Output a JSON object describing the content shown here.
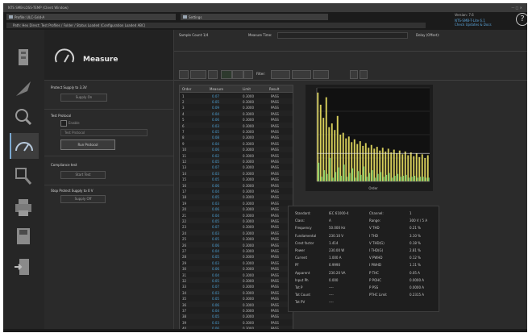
{
  "app": {
    "title": "NTS SMB-LOSS-TEMP (Client Window)",
    "window_controls": "— □ ✕",
    "tab1": "Profile: ULC-Grid-A",
    "tab2": "Settings",
    "path": "Path: Hex  Direct: Test Profiles / Folder / Status Loaded (Configuration Loaded ABC)",
    "version": "Version: 7.6",
    "link1": "NTS-SMB-T-Lite 6.1",
    "link2": "Check Updates & Docs"
  },
  "rail": {
    "items": [
      "device",
      "wave",
      "search",
      "measure",
      "inspect",
      "print",
      "export",
      "exit"
    ]
  },
  "panel": {
    "title": "Measure",
    "s1_title": "Protect Supply to 3.3V",
    "s1_btn": "Supply On",
    "s2_title": "Test Protocol",
    "s2_check": "Enable",
    "s2_field": "Test Protocol",
    "s2_btn": "Run Protocol",
    "s3_title": "Compliance test",
    "s3_btn": "Start Test",
    "s4_title": "Stop Protect Supply to 0 V",
    "s4_btn": "Supply Off"
  },
  "main": {
    "sample_count_label": "Sample Count:",
    "sample_count": "1/4",
    "measure_time_label": "Measure Time:",
    "delay_label": "Delay (Offset):",
    "filter_label": "Filter:",
    "table_headers": [
      "Order",
      "Measure",
      "Limit",
      "Result"
    ],
    "rows": [
      {
        "order": "1",
        "measure": "0.07",
        "limit": "0.3000",
        "result": "PASS"
      },
      {
        "order": "2",
        "measure": "0.05",
        "limit": "0.3000",
        "result": "PASS"
      },
      {
        "order": "3",
        "measure": "0.09",
        "limit": "0.3000",
        "result": "PASS"
      },
      {
        "order": "4",
        "measure": "0.04",
        "limit": "0.3000",
        "result": "PASS"
      },
      {
        "order": "5",
        "measure": "0.06",
        "limit": "0.3000",
        "result": "PASS"
      },
      {
        "order": "6",
        "measure": "0.03",
        "limit": "0.3000",
        "result": "PASS"
      },
      {
        "order": "7",
        "measure": "0.05",
        "limit": "0.3000",
        "result": "PASS"
      },
      {
        "order": "8",
        "measure": "0.08",
        "limit": "0.3000",
        "result": "PASS"
      },
      {
        "order": "9",
        "measure": "0.04",
        "limit": "0.3000",
        "result": "PASS"
      },
      {
        "order": "10",
        "measure": "0.06",
        "limit": "0.3000",
        "result": "PASS"
      },
      {
        "order": "11",
        "measure": "0.02",
        "limit": "0.3000",
        "result": "PASS"
      },
      {
        "order": "12",
        "measure": "0.05",
        "limit": "0.3000",
        "result": "PASS"
      },
      {
        "order": "13",
        "measure": "0.07",
        "limit": "0.3000",
        "result": "PASS"
      },
      {
        "order": "14",
        "measure": "0.03",
        "limit": "0.3000",
        "result": "PASS"
      },
      {
        "order": "15",
        "measure": "0.05",
        "limit": "0.3000",
        "result": "PASS"
      },
      {
        "order": "16",
        "measure": "0.06",
        "limit": "0.3000",
        "result": "PASS"
      },
      {
        "order": "17",
        "measure": "0.04",
        "limit": "0.3000",
        "result": "PASS"
      },
      {
        "order": "18",
        "measure": "0.05",
        "limit": "0.3000",
        "result": "PASS"
      },
      {
        "order": "19",
        "measure": "0.03",
        "limit": "0.3000",
        "result": "PASS"
      },
      {
        "order": "20",
        "measure": "0.06",
        "limit": "0.3000",
        "result": "PASS"
      },
      {
        "order": "21",
        "measure": "0.04",
        "limit": "0.3000",
        "result": "PASS"
      },
      {
        "order": "22",
        "measure": "0.05",
        "limit": "0.3000",
        "result": "PASS"
      },
      {
        "order": "23",
        "measure": "0.07",
        "limit": "0.3000",
        "result": "PASS"
      },
      {
        "order": "24",
        "measure": "0.03",
        "limit": "0.3000",
        "result": "PASS"
      },
      {
        "order": "25",
        "measure": "0.05",
        "limit": "0.3000",
        "result": "PASS"
      },
      {
        "order": "26",
        "measure": "0.06",
        "limit": "0.3000",
        "result": "PASS"
      },
      {
        "order": "27",
        "measure": "0.04",
        "limit": "0.3000",
        "result": "PASS"
      },
      {
        "order": "28",
        "measure": "0.05",
        "limit": "0.3000",
        "result": "PASS"
      },
      {
        "order": "29",
        "measure": "0.03",
        "limit": "0.3000",
        "result": "PASS"
      },
      {
        "order": "30",
        "measure": "0.06",
        "limit": "0.3000",
        "result": "PASS"
      },
      {
        "order": "31",
        "measure": "0.04",
        "limit": "0.3000",
        "result": "PASS"
      },
      {
        "order": "32",
        "measure": "0.05",
        "limit": "0.3000",
        "result": "PASS"
      },
      {
        "order": "33",
        "measure": "0.07",
        "limit": "0.3000",
        "result": "PASS"
      },
      {
        "order": "34",
        "measure": "0.03",
        "limit": "0.3000",
        "result": "PASS"
      },
      {
        "order": "35",
        "measure": "0.05",
        "limit": "0.3000",
        "result": "PASS"
      },
      {
        "order": "36",
        "measure": "0.06",
        "limit": "0.3000",
        "result": "PASS"
      },
      {
        "order": "37",
        "measure": "0.04",
        "limit": "0.3000",
        "result": "PASS"
      },
      {
        "order": "38",
        "measure": "0.05",
        "limit": "0.3000",
        "result": "PASS"
      },
      {
        "order": "39",
        "measure": "0.03",
        "limit": "0.3000",
        "result": "PASS"
      },
      {
        "order": "40",
        "measure": "0.06",
        "limit": "0.3000",
        "result": "PASS"
      }
    ],
    "stats": [
      {
        "label": "Standard:",
        "value": "IEC 61000-4",
        "label2": "Channel:",
        "value2": "1"
      },
      {
        "label": "Class:",
        "value": "A",
        "label2": "Range:",
        "value2": "300 V / 5 A"
      },
      {
        "label": "Frequency",
        "value": "50.000 Hz",
        "label2": "V THD",
        "value2": "0.21 %"
      },
      {
        "label": "Fundamental",
        "value": "230.10 V",
        "label2": "I THD",
        "value2": "3.10 %"
      },
      {
        "label": "Crest factor",
        "value": "1.414",
        "label2": "V THD(G)",
        "value2": "0.18 %"
      },
      {
        "label": "Power",
        "value": "230.00 W",
        "label2": "I THD(G)",
        "value2": "2.81 %"
      },
      {
        "label": "Current",
        "value": "1.000 A",
        "label2": "V PWHD",
        "value2": "0.12 %"
      },
      {
        "label": "PF",
        "value": "0.9990",
        "label2": "I PWHD",
        "value2": "1.11 %"
      },
      {
        "label": "Apparent",
        "value": "230.20 VA",
        "label2": "P THC",
        "value2": "0.05 A"
      },
      {
        "label": "Input Ph",
        "value": "0.000",
        "label2": "P POHC",
        "value2": "0.0000 A"
      },
      {
        "label": "Tot P",
        "value": "----",
        "label2": "P PSS",
        "value2": "0.0000 A"
      },
      {
        "label": "Tot Count",
        "value": "----",
        "label2": "PTHC Limit",
        "value2": "0.2315 A"
      },
      {
        "label": "Tot PV",
        "value": "----",
        "label2": "",
        "value2": ""
      }
    ]
  },
  "chart_data": {
    "type": "bar",
    "title": "",
    "xlabel": "Order",
    "ylabel": "",
    "x": [
      1,
      2,
      3,
      4,
      5,
      6,
      7,
      8,
      9,
      10,
      11,
      12,
      13,
      14,
      15,
      16,
      17,
      18,
      19,
      20,
      21,
      22,
      23,
      24,
      25,
      26,
      27,
      28,
      29,
      30,
      31,
      32,
      33,
      34,
      35,
      36,
      37,
      38,
      39,
      40
    ],
    "series": [
      {
        "color": "#d6cd5a",
        "values": [
          0.95,
          0.82,
          0.68,
          0.9,
          0.58,
          0.62,
          0.55,
          0.7,
          0.5,
          0.52,
          0.46,
          0.48,
          0.42,
          0.45,
          0.4,
          0.43,
          0.38,
          0.41,
          0.36,
          0.39,
          0.35,
          0.37,
          0.33,
          0.36,
          0.32,
          0.35,
          0.31,
          0.34,
          0.3,
          0.33,
          0.29,
          0.32,
          0.28,
          0.31,
          0.27,
          0.3,
          0.26,
          0.29,
          0.25,
          0.28
        ]
      },
      {
        "color": "#7fcf6e",
        "values": [
          0.2,
          0.05,
          0.12,
          0.08,
          0.25,
          0.04,
          0.1,
          0.15,
          0.06,
          0.18,
          0.05,
          0.09,
          0.14,
          0.04,
          0.11,
          0.07,
          0.16,
          0.05,
          0.09,
          0.12,
          0.04,
          0.08,
          0.1,
          0.05,
          0.07,
          0.09,
          0.04,
          0.06,
          0.08,
          0.05,
          0.06,
          0.07,
          0.04,
          0.05,
          0.06,
          0.04,
          0.05,
          0.05,
          0.04,
          0.04
        ]
      }
    ],
    "limit_line": 0.3,
    "ylim": [
      0,
      1
    ],
    "grid": true
  }
}
